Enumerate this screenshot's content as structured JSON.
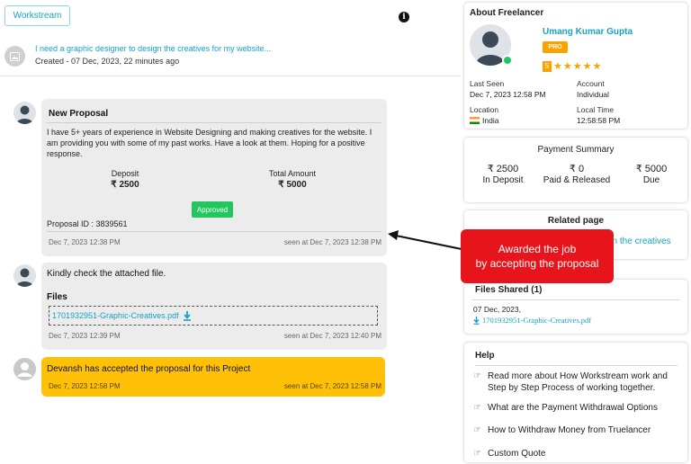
{
  "header": {
    "workstream_label": "Workstream",
    "info_label": "i",
    "project_title": "I need a graphic designer to design the creatives for my website...",
    "project_created": "Created - 07 Dec, 2023, 22 minutes ago"
  },
  "messages": {
    "proposal": {
      "title": "New Proposal",
      "body": "I have 5+ years of experience in Website Designing and making creatives for the website. I am providing you with some of my past works. Have a look at them. Hoping for a positive response.",
      "deposit_label": "Deposit",
      "deposit_value": "₹ 2500",
      "total_label": "Total Amount",
      "total_value": "₹ 5000",
      "status": "Approved",
      "proposal_id": "Proposal ID : 3839561",
      "time": "Dec 7, 2023 12:38 PM",
      "seen": "seen at Dec 7, 2023 12:38 PM"
    },
    "files_msg": {
      "text": "Kindly check the attached file.",
      "files_label": "Files",
      "file_name": "1701932951-Graphic-Creatives.pdf",
      "time": "Dec 7, 2023 12:39 PM",
      "seen": "seen at Dec 7, 2023 12:40 PM"
    },
    "accepted": {
      "text": "Devansh has accepted the proposal for this Project",
      "time": "Dec 7, 2023 12:58 PM",
      "seen": "seen at Dec 7, 2023 12:58 PM"
    }
  },
  "callout": {
    "line1": "Awarded the job",
    "line2": "by accepting the proposal"
  },
  "freelancer": {
    "section_title": "About Freelancer",
    "name": "Umang Kumar Gupta",
    "badge": "PRO",
    "rating": "5",
    "stars": "★★★★★",
    "last_seen_label": "Last Seen",
    "last_seen_value": "Dec 7, 2023 12:58 PM",
    "account_label": "Account",
    "account_value": "Individual",
    "location_label": "Location",
    "location_value": "India",
    "local_time_label": "Local Time",
    "local_time_value": "12:58:58 PM"
  },
  "payment": {
    "title": "Payment Summary",
    "deposit_value": "₹ 2500",
    "deposit_label": "In Deposit",
    "paid_value": "₹ 0",
    "paid_label": "Paid & Released",
    "due_value": "₹ 5000",
    "due_label": "Due"
  },
  "related": {
    "title": "Related page",
    "link_visible": "gn the creatives"
  },
  "files_shared": {
    "title": "Files Shared (1)",
    "date": "07 Dec, 2023,",
    "file_name": "1701932951-Graphic-Creatives.pdf"
  },
  "help": {
    "title": "Help",
    "items": [
      "Read more about How Workstream work and Step by Step Process of working together.",
      "What are the Payment Withdrawal Options",
      "How to Withdraw Money from Truelancer",
      "Custom Quote"
    ]
  },
  "colors": {
    "accent": "#17a2c7",
    "approved": "#22c55e",
    "accepted_bg": "#ffc107",
    "callout": "#e8141b",
    "pro_badge": "#f7a400"
  }
}
